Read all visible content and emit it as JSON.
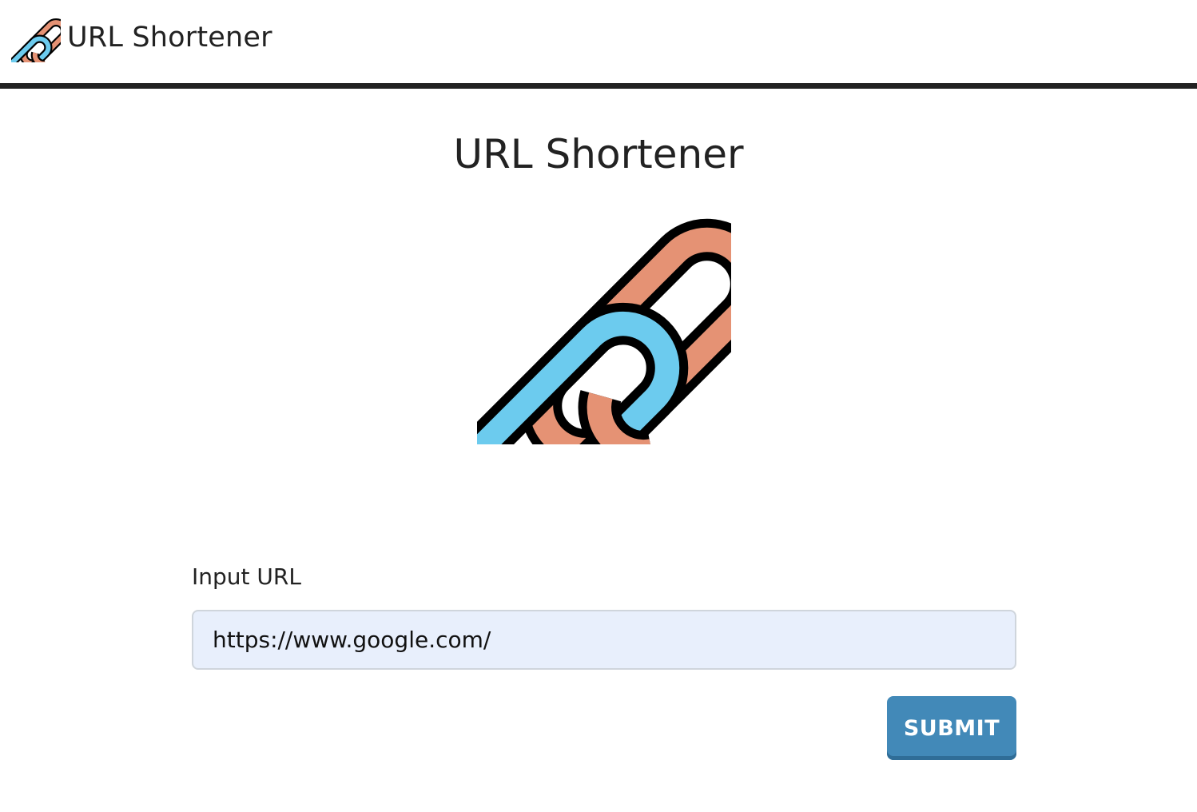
{
  "navbar": {
    "brand_text": "URL Shortener",
    "brand_icon": "chain-link-icon"
  },
  "main": {
    "title": "URL Shortener",
    "hero_icon": "chain-link-icon"
  },
  "form": {
    "label": "Input URL",
    "input_value": "https://www.google.com/",
    "submit_label": "SUBMIT"
  },
  "colors": {
    "link_orange": "#E59274",
    "link_blue": "#6CCBEE",
    "outline": "#000000",
    "input_bg": "#E8EFFC",
    "button_bg": "#4289B8",
    "divider": "#222222"
  }
}
